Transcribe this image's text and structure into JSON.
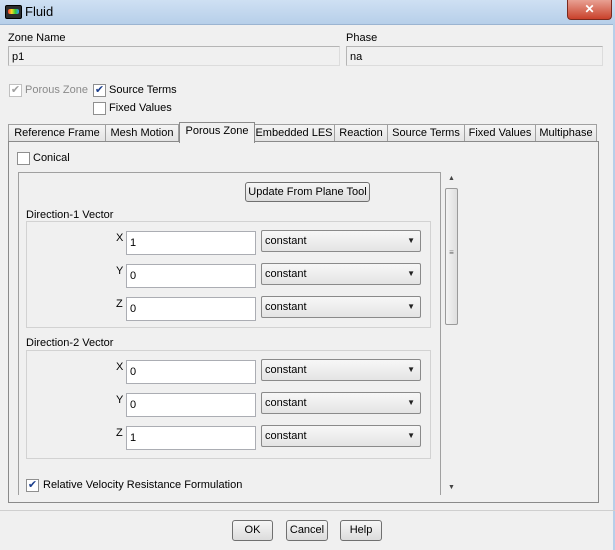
{
  "window": {
    "title": "Fluid",
    "close_glyph": "✕",
    "title_icon": "fluent-app-icon"
  },
  "zone_name": {
    "label": "Zone Name",
    "value": "p1"
  },
  "phase": {
    "label": "Phase",
    "value": "na"
  },
  "options": {
    "porous_zone": {
      "label": "Porous Zone",
      "checked": true,
      "disabled": true
    },
    "source_terms": {
      "label": "Source Terms",
      "checked": true
    },
    "fixed_values": {
      "label": "Fixed Values",
      "checked": false
    }
  },
  "tabs": [
    {
      "label": "Reference Frame"
    },
    {
      "label": "Mesh Motion"
    },
    {
      "label": "Porous Zone",
      "active": true
    },
    {
      "label": "Embedded LES"
    },
    {
      "label": "Reaction"
    },
    {
      "label": "Source Terms"
    },
    {
      "label": "Fixed Values"
    },
    {
      "label": "Multiphase"
    }
  ],
  "conical": {
    "label": "Conical",
    "checked": false
  },
  "update_button": "Update From Plane Tool",
  "direction1": {
    "title": "Direction-1 Vector",
    "rows": [
      {
        "axis": "X",
        "value": "1",
        "method": "constant"
      },
      {
        "axis": "Y",
        "value": "0",
        "method": "constant"
      },
      {
        "axis": "Z",
        "value": "0",
        "method": "constant"
      }
    ]
  },
  "direction2": {
    "title": "Direction-2 Vector",
    "rows": [
      {
        "axis": "X",
        "value": "0",
        "method": "constant"
      },
      {
        "axis": "Y",
        "value": "0",
        "method": "constant"
      },
      {
        "axis": "Z",
        "value": "1",
        "method": "constant"
      }
    ]
  },
  "relative_velocity": {
    "label": "Relative Velocity Resistance Formulation",
    "checked": true
  },
  "check_glyph": "✔",
  "dropdown_glyph": "▼",
  "scroll": {
    "up_glyph": "▲",
    "down_glyph": "▼",
    "grip_glyph": "≡"
  },
  "footer": {
    "ok": "OK",
    "cancel": "Cancel",
    "help": "Help"
  }
}
